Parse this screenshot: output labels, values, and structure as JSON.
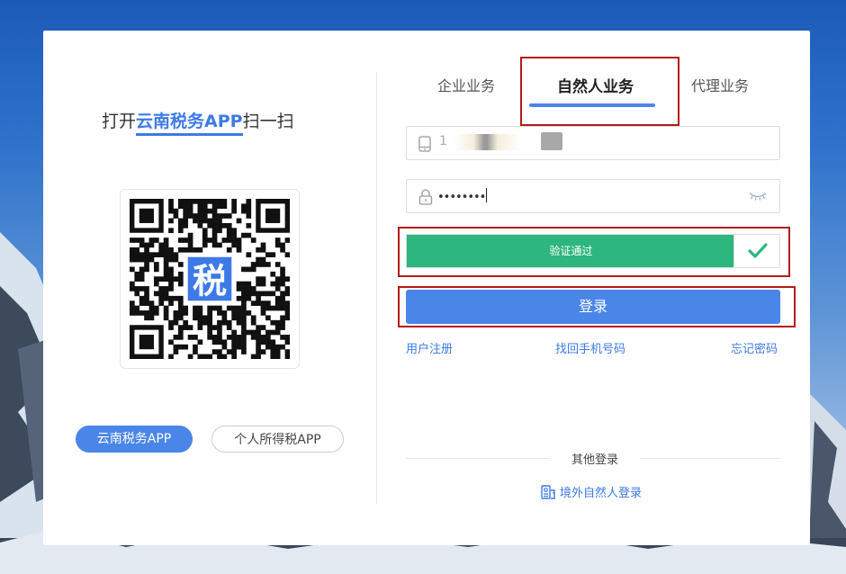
{
  "left": {
    "scan_prefix": "打开",
    "scan_app": "云南税务APP",
    "scan_suffix": "扫一扫",
    "qr_center_char": "税",
    "app_buttons": [
      "云南税务APP",
      "个人所得税APP"
    ]
  },
  "tabs": [
    {
      "label": "企业业务",
      "active": false
    },
    {
      "label": "自然人业务",
      "active": true
    },
    {
      "label": "代理业务",
      "active": false
    }
  ],
  "form": {
    "phone_value": "1",
    "password_value": "••••••••",
    "verify_label": "验证通过",
    "login_label": "登录"
  },
  "links": [
    "用户注册",
    "找回手机号码",
    "忘记密码"
  ],
  "other": {
    "title": "其他登录",
    "overseas_label": "境外自然人登录"
  },
  "colors": {
    "accent": "#4a86e8",
    "verify_green": "#2db77e",
    "highlight_red": "#b31b1b"
  }
}
